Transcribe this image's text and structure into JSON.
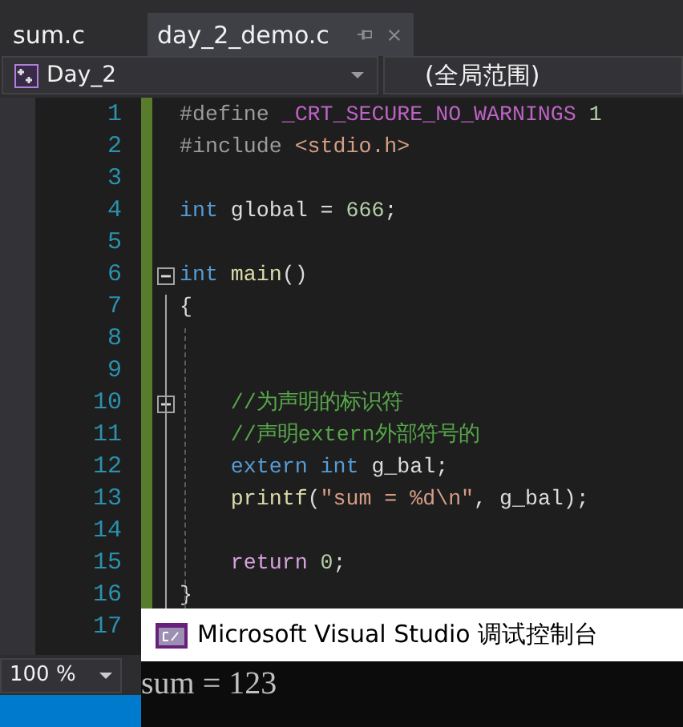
{
  "tabs": [
    {
      "label": "sum.c",
      "selected": false,
      "pinned": false
    },
    {
      "label": "day_2_demo.c",
      "selected": true,
      "pinned": true
    }
  ],
  "navigation": {
    "project": "Day_2",
    "scope": "(全局范围)"
  },
  "code": {
    "lines": [
      {
        "number": "1",
        "fold_start": false,
        "tokens": [
          {
            "kind": "preproc",
            "text": "#define "
          },
          {
            "kind": "macro",
            "text": "_CRT_SECURE_NO_WARNINGS "
          },
          {
            "kind": "number",
            "text": "1"
          }
        ]
      },
      {
        "number": "2",
        "fold_start": false,
        "tokens": [
          {
            "kind": "preproc",
            "text": "#include "
          },
          {
            "kind": "string",
            "text": "<stdio.h>"
          }
        ]
      },
      {
        "number": "3",
        "fold_start": false
      },
      {
        "number": "4",
        "fold_start": false,
        "tokens": [
          {
            "kind": "keyword",
            "text": "int"
          },
          {
            "kind": "plain",
            "text": " global = "
          },
          {
            "kind": "number",
            "text": "666"
          },
          {
            "kind": "plain",
            "text": ";"
          }
        ]
      },
      {
        "number": "5",
        "fold_start": false
      },
      {
        "number": "6",
        "fold_start": true,
        "tokens": [
          {
            "kind": "keyword",
            "text": "int "
          },
          {
            "kind": "function",
            "text": "main"
          },
          {
            "kind": "plain",
            "text": "()"
          }
        ]
      },
      {
        "number": "7",
        "fold_start": false,
        "tokens": [
          {
            "kind": "plain",
            "text": "{"
          }
        ]
      },
      {
        "number": "8",
        "fold_start": false
      },
      {
        "number": "9",
        "fold_start": false
      },
      {
        "number": "10",
        "fold_start": true,
        "tokens": [
          {
            "kind": "comment",
            "text": "    //为声明的标识符"
          }
        ]
      },
      {
        "number": "11",
        "fold_start": false,
        "tokens": [
          {
            "kind": "comment",
            "text": "    //声明extern外部符号的"
          }
        ]
      },
      {
        "number": "12",
        "fold_start": false,
        "tokens": [
          {
            "kind": "keyword",
            "text": "    extern int"
          },
          {
            "kind": "plain",
            "text": " g_bal;"
          }
        ]
      },
      {
        "number": "13",
        "fold_start": false,
        "tokens": [
          {
            "kind": "function",
            "text": "    printf"
          },
          {
            "kind": "plain",
            "text": "("
          },
          {
            "kind": "string",
            "text": "\"sum = %d\\n\""
          },
          {
            "kind": "plain",
            "text": ", g_bal);"
          }
        ]
      },
      {
        "number": "14",
        "fold_start": false
      },
      {
        "number": "15",
        "fold_start": false,
        "tokens": [
          {
            "kind": "control",
            "text": "    return "
          },
          {
            "kind": "number",
            "text": "0"
          },
          {
            "kind": "plain",
            "text": ";"
          }
        ]
      },
      {
        "number": "16",
        "fold_start": false,
        "tokens": [
          {
            "kind": "plain",
            "text": "}"
          }
        ]
      },
      {
        "number": "17",
        "fold_start": false
      }
    ]
  },
  "zoom": "100 %",
  "console": {
    "title": "Microsoft Visual Studio 调试控制台",
    "output": "sum = 123"
  }
}
